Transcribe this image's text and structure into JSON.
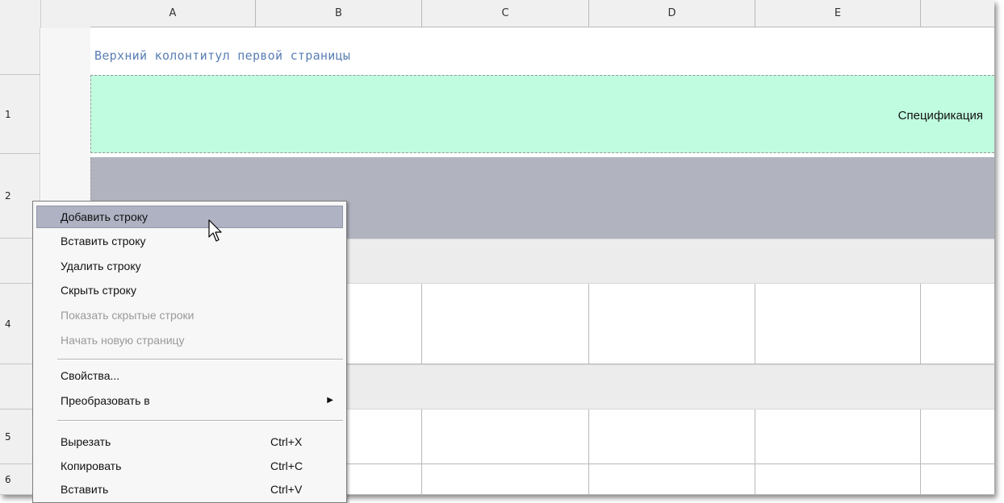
{
  "columns": [
    "A",
    "B",
    "C",
    "D",
    "E",
    ""
  ],
  "rows": [
    "1",
    "2",
    "",
    "4",
    "",
    "5",
    "6"
  ],
  "header_note": "Верхний колонтитул первой страницы",
  "title_cell": "Спецификация",
  "context_menu": {
    "items": [
      {
        "label": "Добавить строку",
        "state": "highlighted"
      },
      {
        "label": "Вставить строку",
        "state": "enabled"
      },
      {
        "label": "Удалить строку",
        "state": "enabled"
      },
      {
        "label": "Скрыть строку",
        "state": "enabled"
      },
      {
        "label": "Показать скрытые строки",
        "state": "disabled"
      },
      {
        "label": "Начать новую страницу",
        "state": "disabled"
      },
      {
        "label": "Свойства...",
        "state": "enabled"
      },
      {
        "label": "Преобразовать в",
        "state": "enabled",
        "submenu": true
      },
      {
        "label": "Вырезать",
        "shortcut": "Ctrl+X",
        "state": "enabled"
      },
      {
        "label": "Копировать",
        "shortcut": "Ctrl+C",
        "state": "enabled"
      },
      {
        "label": "Вставить",
        "shortcut": "Ctrl+V",
        "state": "enabled"
      }
    ]
  },
  "colors": {
    "title_band": "#c0fde0",
    "gray_band": "#b1b3bf",
    "menu_highlight": "#aeb2c2",
    "header_note_text": "#5a7fb3"
  }
}
